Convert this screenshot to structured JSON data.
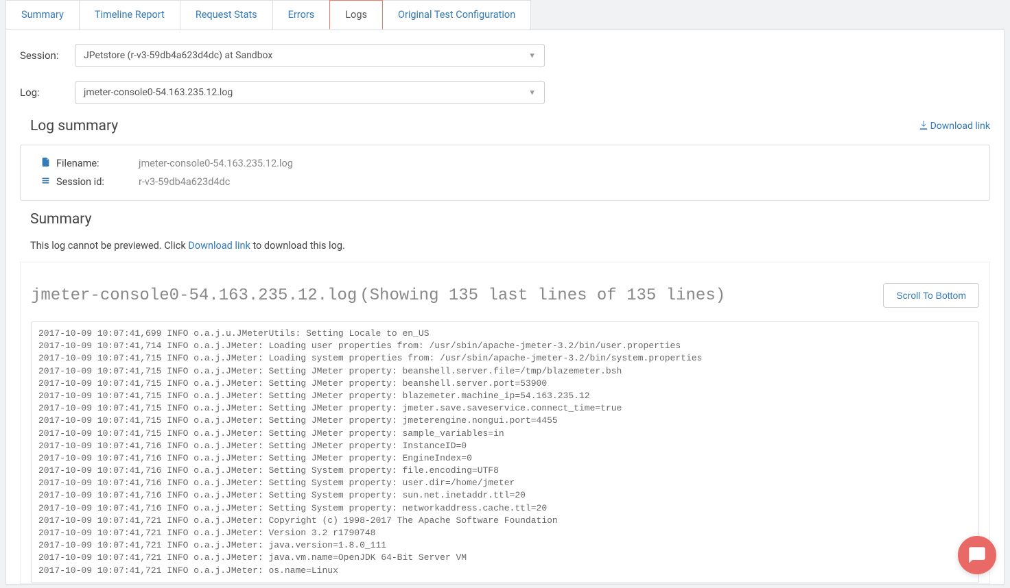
{
  "tabs": {
    "items": [
      {
        "label": "Summary"
      },
      {
        "label": "Timeline Report"
      },
      {
        "label": "Request Stats"
      },
      {
        "label": "Errors"
      },
      {
        "label": "Logs"
      },
      {
        "label": "Original Test Configuration"
      }
    ],
    "active_index": 4
  },
  "form": {
    "session_label": "Session:",
    "session_value": "JPetstore (r-v3-59db4a623d4dc) at Sandbox",
    "log_label": "Log:",
    "log_value": "jmeter-console0-54.163.235.12.log"
  },
  "summary_header": "Log summary",
  "download_link_label": "Download link",
  "info": {
    "filename_label": "Filename:",
    "filename_value": "jmeter-console0-54.163.235.12.log",
    "sessionid_label": "Session id:",
    "sessionid_value": "r-v3-59db4a623d4dc"
  },
  "summary_box": {
    "title": "Summary",
    "text_pre": "This log cannot be previewed. Click ",
    "link": "Download link",
    "text_post": " to download this log."
  },
  "log_view": {
    "filename": "jmeter-console0-54.163.235.12.log",
    "meta": "(Showing 135 last lines of 135 lines)",
    "scroll_btn": "Scroll To Bottom",
    "lines": [
      "2017-10-09 10:07:41,699 INFO o.a.j.u.JMeterUtils: Setting Locale to en_US",
      "2017-10-09 10:07:41,714 INFO o.a.j.JMeter: Loading user properties from: /usr/sbin/apache-jmeter-3.2/bin/user.properties",
      "2017-10-09 10:07:41,715 INFO o.a.j.JMeter: Loading system properties from: /usr/sbin/apache-jmeter-3.2/bin/system.properties",
      "2017-10-09 10:07:41,715 INFO o.a.j.JMeter: Setting JMeter property: beanshell.server.file=/tmp/blazemeter.bsh",
      "2017-10-09 10:07:41,715 INFO o.a.j.JMeter: Setting JMeter property: beanshell.server.port=53900",
      "2017-10-09 10:07:41,715 INFO o.a.j.JMeter: Setting JMeter property: blazemeter.machine_ip=54.163.235.12",
      "2017-10-09 10:07:41,715 INFO o.a.j.JMeter: Setting JMeter property: jmeter.save.saveservice.connect_time=true",
      "2017-10-09 10:07:41,715 INFO o.a.j.JMeter: Setting JMeter property: jmeterengine.nongui.port=4455",
      "2017-10-09 10:07:41,715 INFO o.a.j.JMeter: Setting JMeter property: sample_variables=in",
      "2017-10-09 10:07:41,716 INFO o.a.j.JMeter: Setting JMeter property: InstanceID=0",
      "2017-10-09 10:07:41,716 INFO o.a.j.JMeter: Setting JMeter property: EngineIndex=0",
      "2017-10-09 10:07:41,716 INFO o.a.j.JMeter: Setting System property: file.encoding=UTF8",
      "2017-10-09 10:07:41,716 INFO o.a.j.JMeter: Setting System property: user.dir=/home/jmeter",
      "2017-10-09 10:07:41,716 INFO o.a.j.JMeter: Setting System property: sun.net.inetaddr.ttl=20",
      "2017-10-09 10:07:41,716 INFO o.a.j.JMeter: Setting System property: networkaddress.cache.ttl=20",
      "2017-10-09 10:07:41,721 INFO o.a.j.JMeter: Copyright (c) 1998-2017 The Apache Software Foundation",
      "2017-10-09 10:07:41,721 INFO o.a.j.JMeter: Version 3.2 r1790748",
      "2017-10-09 10:07:41,721 INFO o.a.j.JMeter: java.version=1.8.0_111",
      "2017-10-09 10:07:41,721 INFO o.a.j.JMeter: java.vm.name=OpenJDK 64-Bit Server VM",
      "2017-10-09 10:07:41,721 INFO o.a.j.JMeter: os.name=Linux"
    ]
  }
}
